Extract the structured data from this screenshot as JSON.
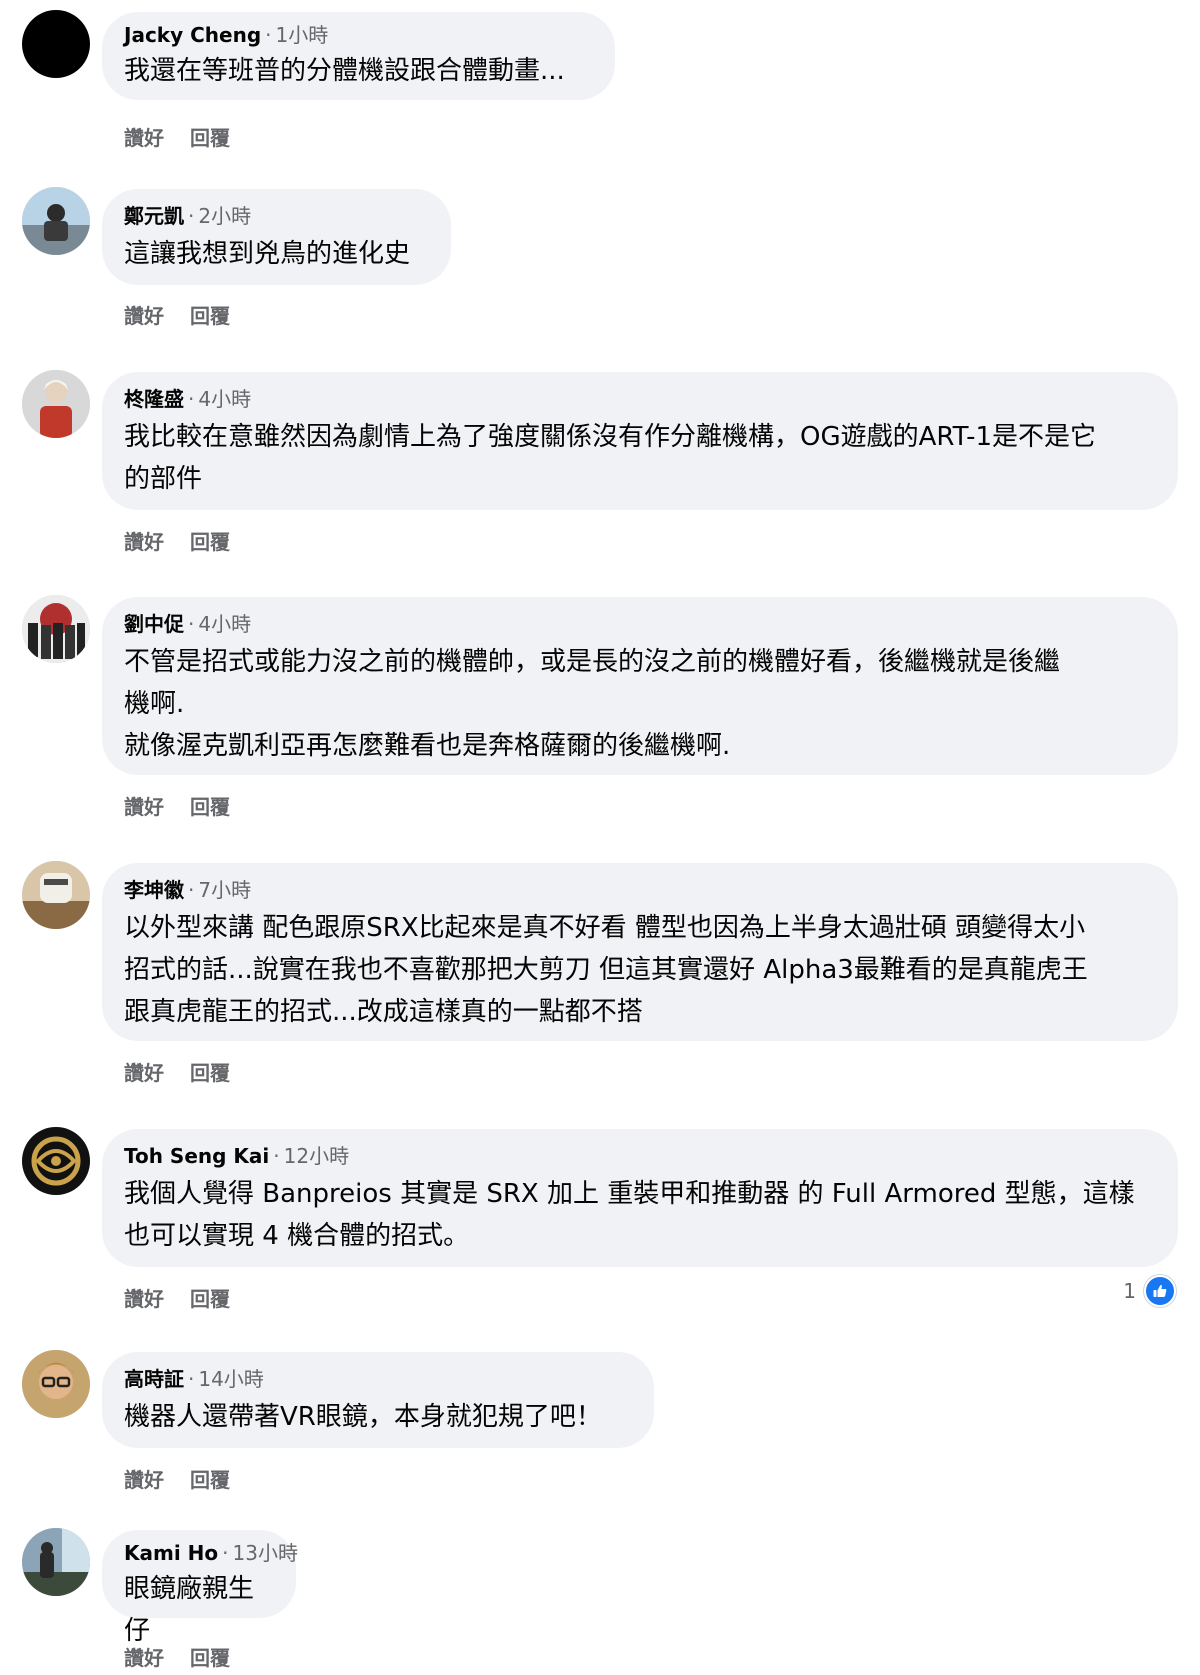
{
  "comments": [
    {
      "name": "Jacky Cheng",
      "time": "1小時",
      "text": "我還在等班普的分體機設跟合體動畫...",
      "like": "讚好",
      "reply": "回覆"
    },
    {
      "name": "鄭元凱",
      "time": "2小時",
      "text": "這讓我想到兇鳥的進化史",
      "like": "讚好",
      "reply": "回覆"
    },
    {
      "name": "柊隆盛",
      "time": "4小時",
      "text": "我比較在意雖然因為劇情上為了強度關係沒有作分離機構，OG遊戲的ART-1是不是它\n的部件",
      "like": "讚好",
      "reply": "回覆"
    },
    {
      "name": "劉中促",
      "time": "4小時",
      "text": "不管是招式或能力沒之前的機體帥，或是長的沒之前的機體好看，後繼機就是後繼\n機啊.\n就像渥克凱利亞再怎麼難看也是奔格薩爾的後繼機啊.",
      "like": "讚好",
      "reply": "回覆"
    },
    {
      "name": "李坤徽",
      "time": "7小時",
      "text": "以外型來講 配色跟原SRX比起來是真不好看 體型也因為上半身太過壯碩 頭變得太小\n招式的話...說實在我也不喜歡那把大剪刀 但這其實還好 Alpha3最難看的是真龍虎王\n跟真虎龍王的招式...改成這樣真的一點都不搭",
      "like": "讚好",
      "reply": "回覆"
    },
    {
      "name": "Toh Seng Kai",
      "time": "12小時",
      "text": "我個人覺得 Banpreios 其實是 SRX 加上 重裝甲和推動器 的 Full Armored 型態，這樣\n也可以實現 4 機合體的招式。",
      "like": "讚好",
      "reply": "回覆",
      "reaction_count": "1"
    },
    {
      "name": "高時証",
      "time": "14小時",
      "text": "機器人還帶著VR眼鏡，本身就犯規了吧！",
      "like": "讚好",
      "reply": "回覆"
    },
    {
      "name": "Kami Ho",
      "time": "13小時",
      "text": "眼鏡廠親生仔",
      "like": "讚好",
      "reply": "回覆"
    }
  ],
  "icons": {
    "like_reaction": "thumbs-up-icon"
  },
  "colors": {
    "bubble": "#f0f2f5",
    "meta": "#65676b",
    "like_blue": "#1877f2"
  }
}
